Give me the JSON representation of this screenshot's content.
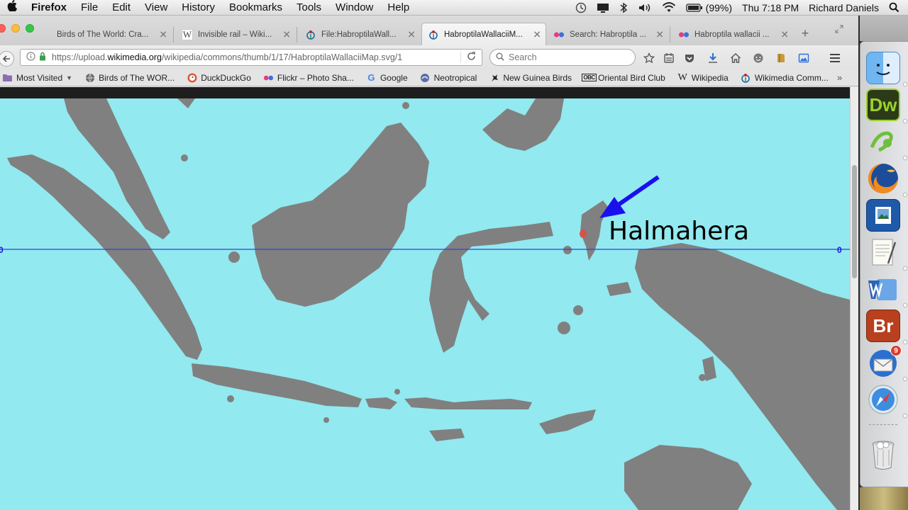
{
  "menubar": {
    "app": "Firefox",
    "items": [
      "File",
      "Edit",
      "View",
      "History",
      "Bookmarks",
      "Tools",
      "Window",
      "Help"
    ],
    "battery": "(99%)",
    "clock": "Thu 7:18 PM",
    "user": "Richard Daniels"
  },
  "tabs": [
    {
      "title": "Birds of The World: Cra...",
      "icon": "globe-icon"
    },
    {
      "title": "Invisible rail – Wiki...",
      "icon": "wikipedia-icon"
    },
    {
      "title": "File:HabroptilaWall...",
      "icon": "wikimedia-icon"
    },
    {
      "title": "HabroptilaWallaciiM...",
      "icon": "wikimedia-icon",
      "active": true
    },
    {
      "title": "Search: Habroptila ...",
      "icon": "flickr-icon"
    },
    {
      "title": "Habroptila wallacii ...",
      "icon": "flickr-icon"
    }
  ],
  "navbar": {
    "url_prefix": "https://upload.",
    "url_domain": "wikimedia.org",
    "url_path": "/wikipedia/commons/thumb/1/17/HabroptilaWallaciiMap.svg/1",
    "search_placeholder": "Search"
  },
  "bookmarks": [
    {
      "label": "Most Visited",
      "icon": "folder-icon",
      "dropdown": true
    },
    {
      "label": "Birds of The WOR...",
      "icon": "globe-icon"
    },
    {
      "label": "DuckDuckGo",
      "icon": "duckduckgo-icon"
    },
    {
      "label": "Flickr – Photo Sha...",
      "icon": "flickr-icon"
    },
    {
      "label": "Google",
      "icon": "google-icon"
    },
    {
      "label": "Neotropical",
      "icon": "neotropical-icon"
    },
    {
      "label": "New Guinea Birds",
      "icon": "bird-icon"
    },
    {
      "label": "Oriental Bird Club",
      "icon": "obc-icon"
    },
    {
      "label": "Wikipedia",
      "icon": "wikipedia-icon"
    },
    {
      "label": "Wikimedia Comm...",
      "icon": "wikimedia-icon"
    }
  ],
  "map": {
    "label": "Halmahera",
    "equator_left": "0",
    "equator_right": "0",
    "colors": {
      "sea": "#92e9ef",
      "land": "#808080",
      "range": "#d9524a",
      "arrow": "#1a10ee",
      "equator": "#3540d8"
    }
  },
  "dock": [
    {
      "name": "finder-icon"
    },
    {
      "name": "dreamweaver-icon",
      "text": "Dw"
    },
    {
      "name": "spreadsheet-app-icon"
    },
    {
      "name": "firefox-icon"
    },
    {
      "name": "preview-icon"
    },
    {
      "name": "textedit-icon"
    },
    {
      "name": "word-icon"
    },
    {
      "name": "bridge-icon",
      "text": "Br"
    },
    {
      "name": "thunderbird-icon",
      "badge": "9"
    },
    {
      "name": "safari-icon"
    },
    {
      "name": "trash-icon"
    }
  ]
}
